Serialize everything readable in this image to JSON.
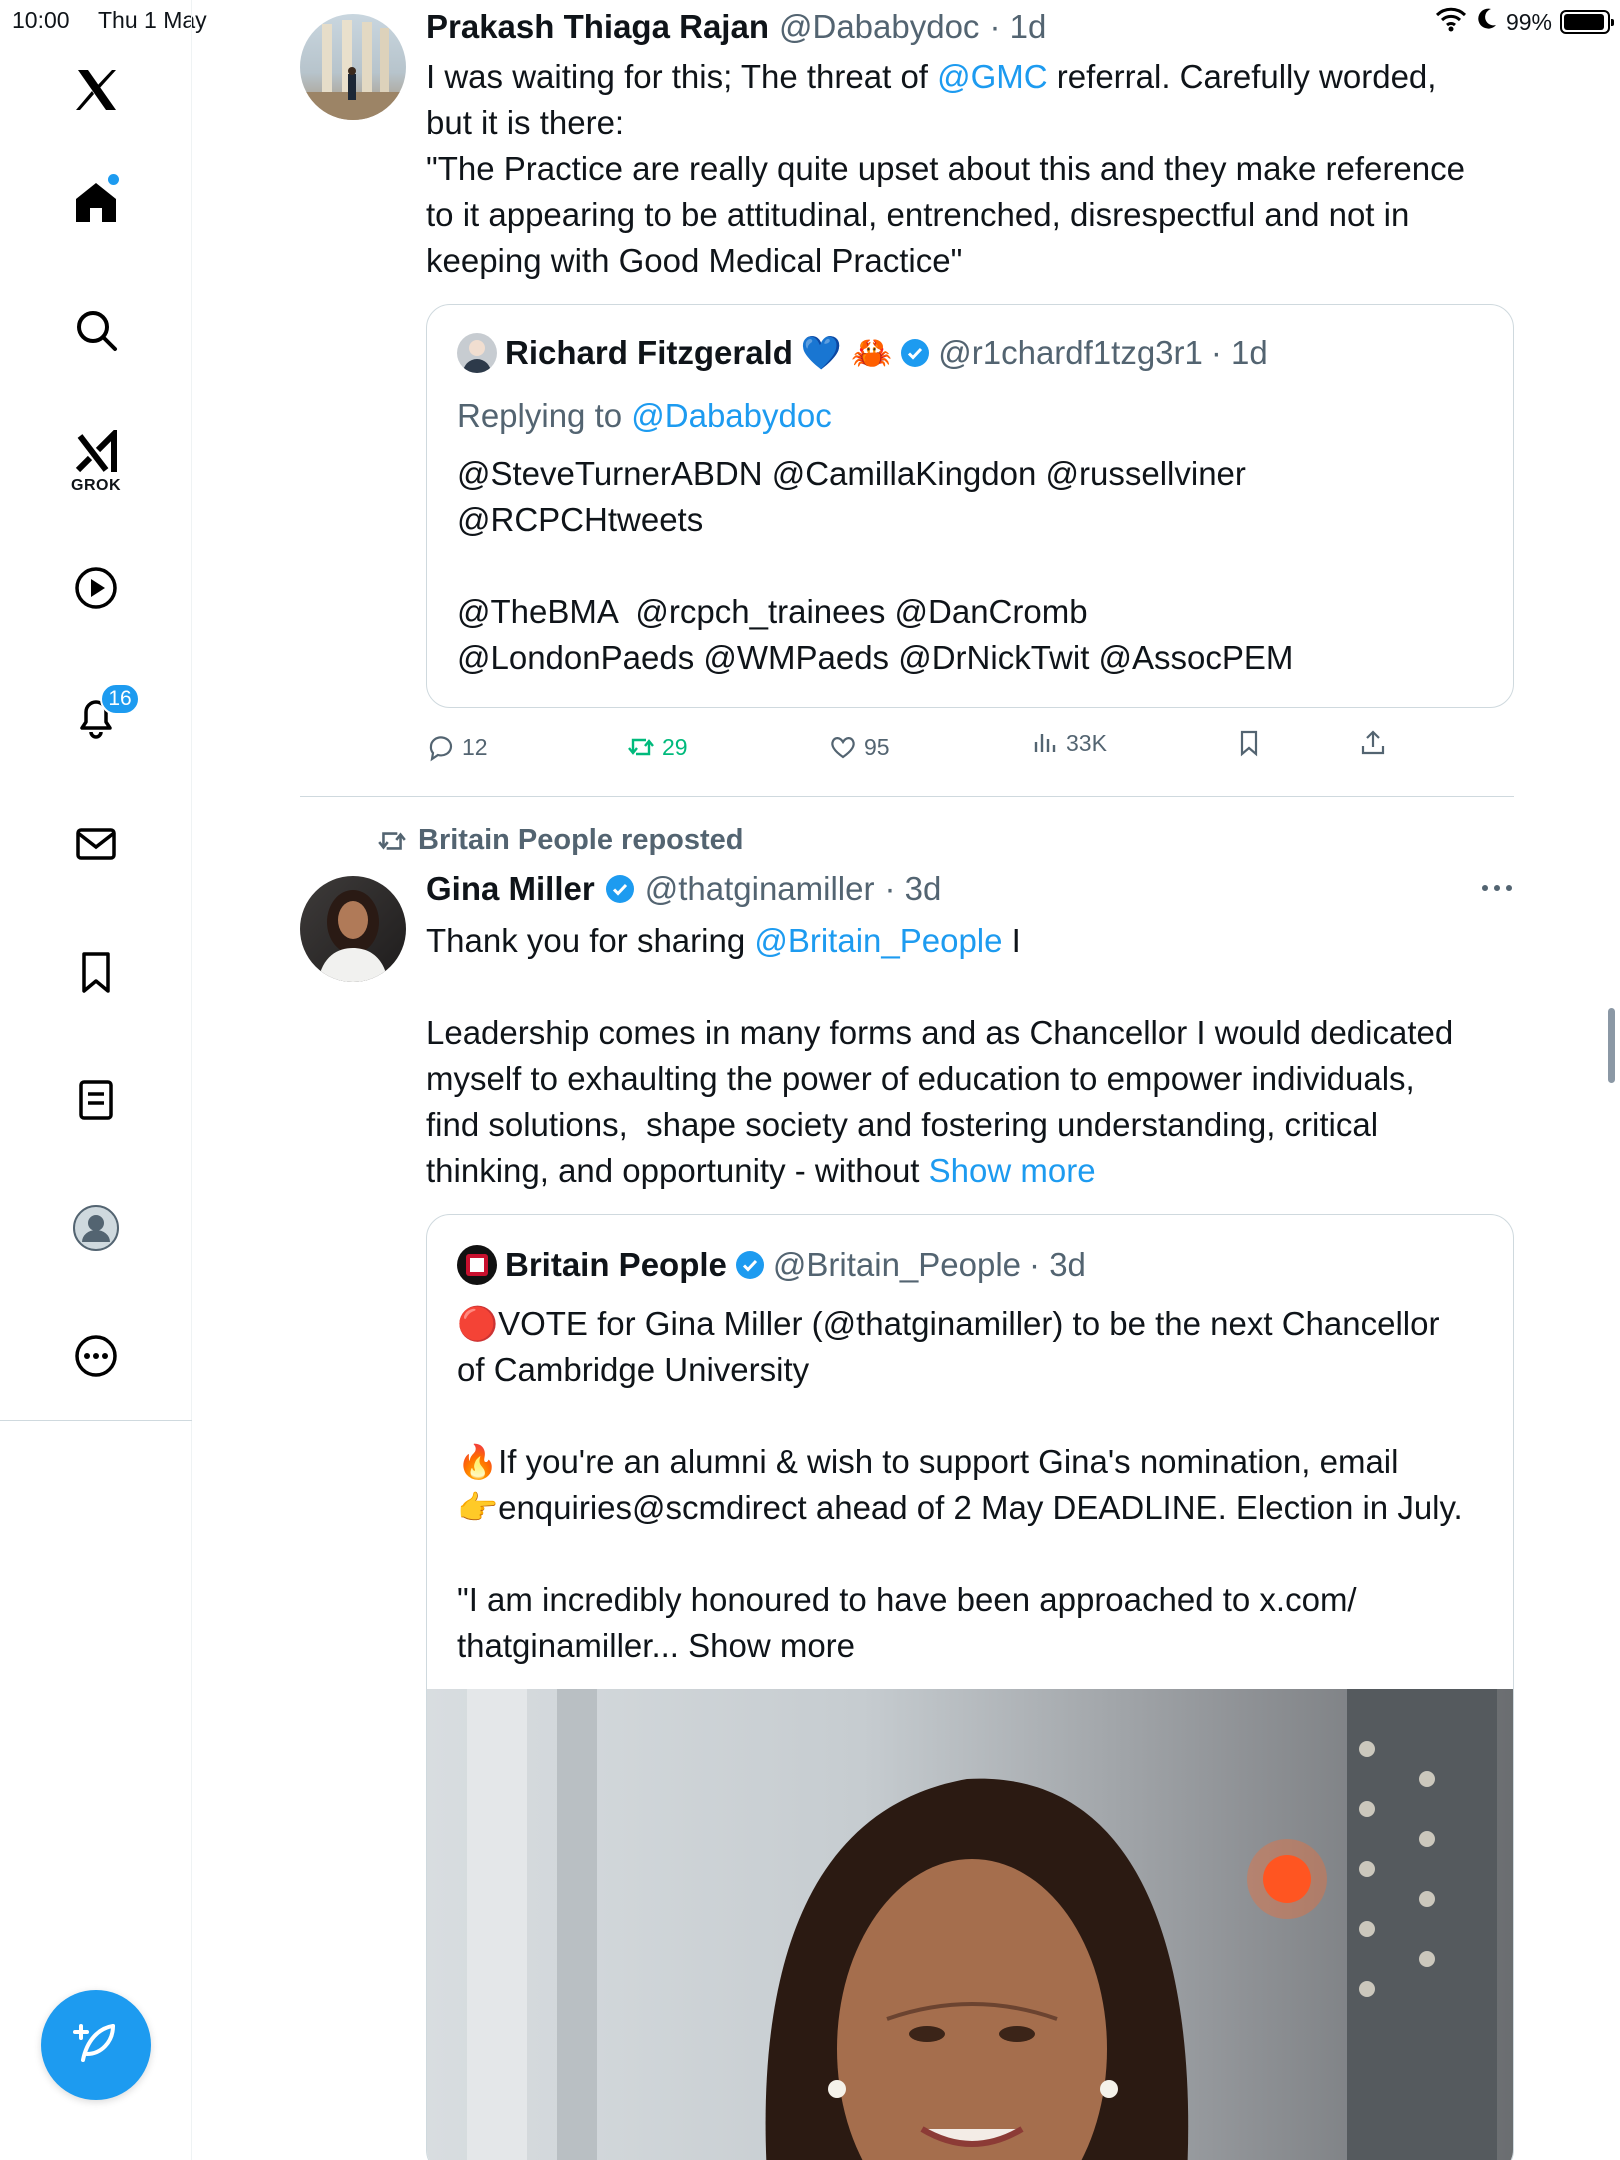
{
  "status_bar": {
    "time": "10:00",
    "date": "Thu 1 May",
    "battery": "99%"
  },
  "sidebar": {
    "items": [
      {
        "label": "Home",
        "icon": "home-icon"
      },
      {
        "label": "Explore",
        "icon": "search-icon"
      },
      {
        "label": "GROK",
        "icon": "grok-icon"
      },
      {
        "label": "Video",
        "icon": "play-icon"
      },
      {
        "label": "Notifications",
        "icon": "bell-icon",
        "badge": "16"
      },
      {
        "label": "Messages",
        "icon": "mail-icon"
      },
      {
        "label": "Bookmarks",
        "icon": "bookmark-icon"
      },
      {
        "label": "Lists",
        "icon": "list-icon"
      },
      {
        "label": "Profile",
        "icon": "profile-icon"
      },
      {
        "label": "More",
        "icon": "more-icon"
      }
    ]
  },
  "tweet1": {
    "name": "Prakash Thiaga Rajan",
    "handle": "@Dababydoc",
    "time": "· 1d",
    "text_a": "I was waiting for this; The threat of ",
    "text_link": "@GMC",
    "text_b": " referral. Carefully worded,\nbut it is there:\n\"The Practice are really quite upset about this and they make reference\nto it appearing to be attitudinal, entrenched, disrespectful and not in\nkeeping with Good Medical Practice\"",
    "quote": {
      "name": "Richard Fitzgerald",
      "emojis": "💙 🦀",
      "handle": "@r1chardf1tzg3r1",
      "time": "· 1d",
      "replying_prefix": "Replying to ",
      "replying_handle": "@Dababydoc",
      "text": "@SteveTurnerABDN @CamillaKingdon @russellviner\n@RCPCHtweets\n\n@TheBMA  @rcpch_trainees @DanCromb\n@LondonPaeds @WMPaeds @DrNickTwit @AssocPEM"
    },
    "actions": {
      "replies": "12",
      "reposts": "29",
      "likes": "95",
      "views": "33K"
    }
  },
  "tweet2": {
    "repost_label": "Britain People reposted",
    "name": "Gina Miller",
    "handle": "@thatginamiller",
    "time": "· 3d",
    "text_a": "Thank you for sharing ",
    "text_link": "@Britain_People",
    "text_b": " I\n\nLeadership comes in many forms and as Chancellor I would dedicated\nmyself to exhaulting the power of education to empower individuals,\nfind solutions,  shape society and fostering understanding, critical\nthinking, and opportunity - without ",
    "show_more": "Show more",
    "quote": {
      "name": "Britain People",
      "handle": "@Britain_People",
      "time": "· 3d",
      "text": "🔴VOTE for Gina Miller (@thatginamiller) to be the next Chancellor\nof Cambridge University\n\n🔥If you're an alumni & wish to support Gina's nomination, email\n👉enquiries@scmdirect ahead of 2 May DEADLINE. Election in July.\n\n\"I am incredibly honoured to have been approached to x.com/\nthatginamiller... Show more"
    }
  },
  "colors": {
    "accent": "#1d9bf0",
    "repost_green": "#00ba7c",
    "muted": "#536471"
  }
}
